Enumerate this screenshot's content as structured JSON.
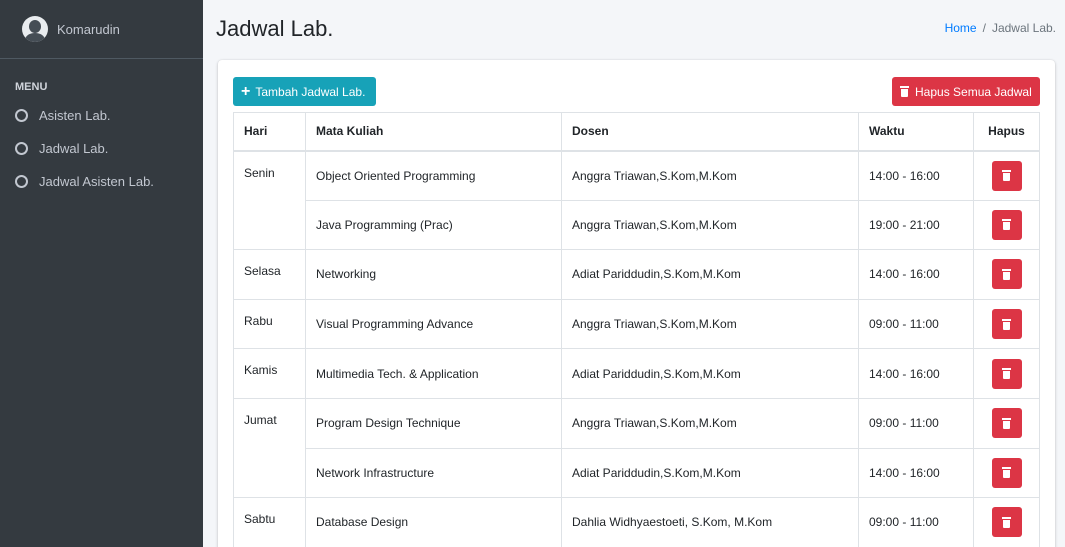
{
  "sidebar": {
    "user_name": "Komarudin",
    "menu_header": "MENU",
    "items": [
      {
        "label": "Asisten Lab."
      },
      {
        "label": "Jadwal Lab."
      },
      {
        "label": "Jadwal Asisten Lab."
      }
    ]
  },
  "header": {
    "title": "Jadwal Lab.",
    "breadcrumb": {
      "home": "Home",
      "separator": "/",
      "current": "Jadwal Lab."
    }
  },
  "toolbar": {
    "add_label": "Tambah Jadwal Lab.",
    "delete_all_label": "Hapus Semua Jadwal"
  },
  "table": {
    "columns": [
      "Hari",
      "Mata Kuliah",
      "Dosen",
      "Waktu",
      "Hapus"
    ],
    "rows": [
      {
        "hari": "Senin",
        "rowspan": 2,
        "mata_kuliah": "Object Oriented Programming",
        "dosen": "Anggra Triawan,S.Kom,M.Kom",
        "waktu": "14:00 - 16:00"
      },
      {
        "hari": null,
        "mata_kuliah": "Java Programming (Prac)",
        "dosen": "Anggra Triawan,S.Kom,M.Kom",
        "waktu": "19:00 - 21:00"
      },
      {
        "hari": "Selasa",
        "rowspan": 1,
        "mata_kuliah": "Networking",
        "dosen": "Adiat Pariddudin,S.Kom,M.Kom",
        "waktu": "14:00 - 16:00"
      },
      {
        "hari": "Rabu",
        "rowspan": 1,
        "mata_kuliah": "Visual Programming Advance",
        "dosen": "Anggra Triawan,S.Kom,M.Kom",
        "waktu": "09:00 - 11:00"
      },
      {
        "hari": "Kamis",
        "rowspan": 1,
        "mata_kuliah": "Multimedia Tech. & Application",
        "dosen": "Adiat Pariddudin,S.Kom,M.Kom",
        "waktu": "14:00 - 16:00"
      },
      {
        "hari": "Jumat",
        "rowspan": 2,
        "mata_kuliah": "Program Design Technique",
        "dosen": "Anggra Triawan,S.Kom,M.Kom",
        "waktu": "09:00 - 11:00"
      },
      {
        "hari": null,
        "mata_kuliah": "Network Infrastructure",
        "dosen": "Adiat Pariddudin,S.Kom,M.Kom",
        "waktu": "14:00 - 16:00"
      },
      {
        "hari": "Sabtu",
        "rowspan": 1,
        "mata_kuliah": "Database Design",
        "dosen": "Dahlia Widhyaestoeti, S.Kom, M.Kom",
        "waktu": "09:00 - 11:00"
      }
    ]
  },
  "colors": {
    "sidebar_bg": "#343a40",
    "info": "#17a2b8",
    "danger": "#dc3545",
    "link": "#007bff"
  }
}
